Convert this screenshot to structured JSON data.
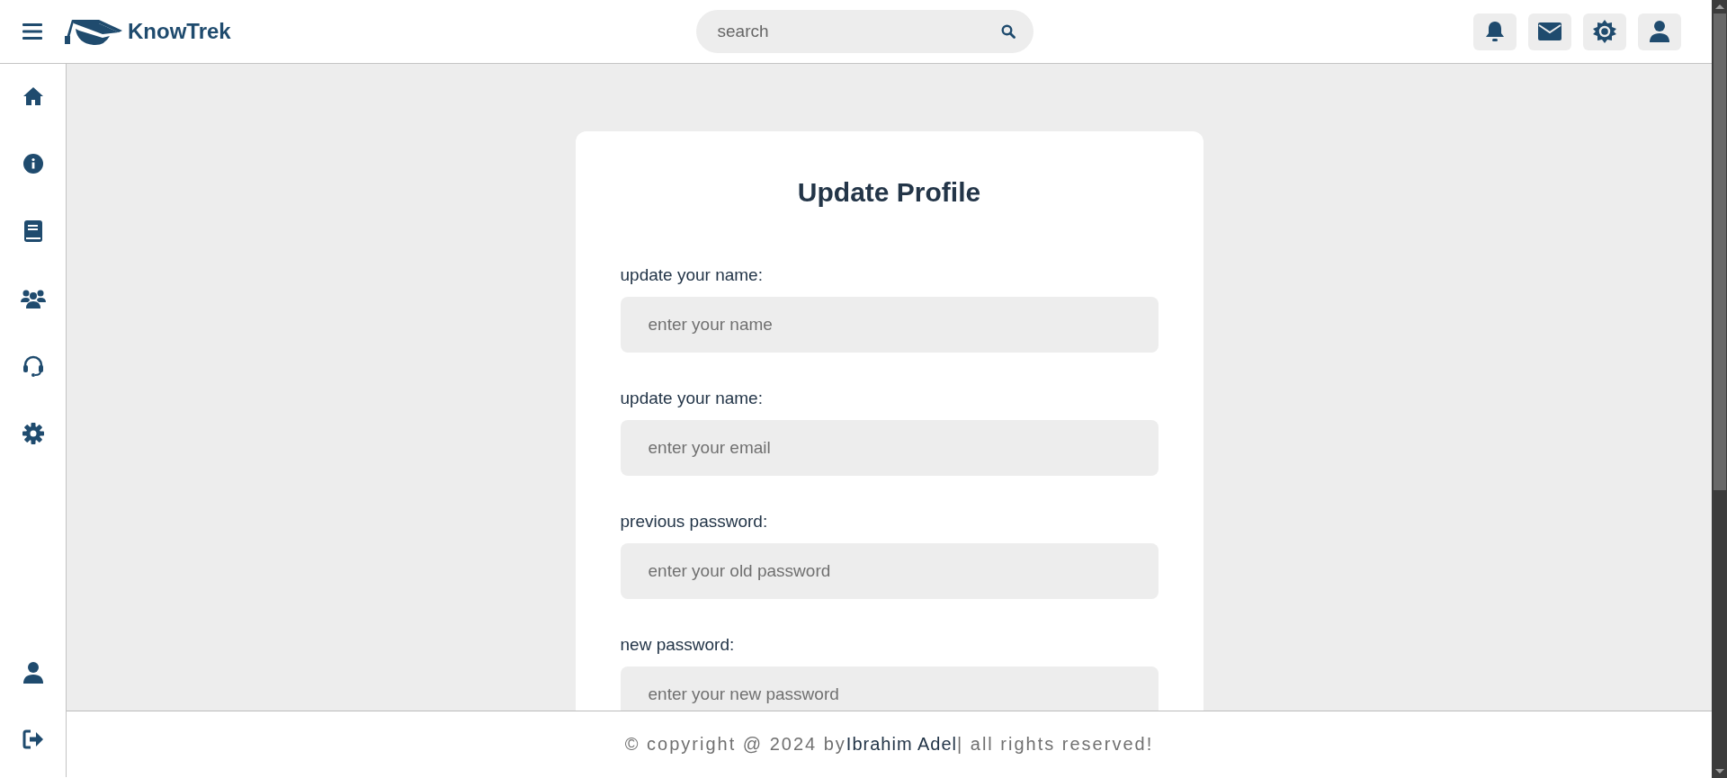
{
  "header": {
    "brand": "KnowTrek",
    "search": {
      "placeholder": "search"
    }
  },
  "form": {
    "title": "Update Profile",
    "fields": [
      {
        "label": "update your name:",
        "placeholder": "enter your name"
      },
      {
        "label": "update your name:",
        "placeholder": "enter your email"
      },
      {
        "label": "previous password:",
        "placeholder": "enter your old password"
      },
      {
        "label": "new password:",
        "placeholder": "enter your new password"
      }
    ]
  },
  "footer": {
    "before": "© copyright @ 2024 by",
    "author": "Ibrahim Adel",
    "after": "| all rights reserved!"
  }
}
